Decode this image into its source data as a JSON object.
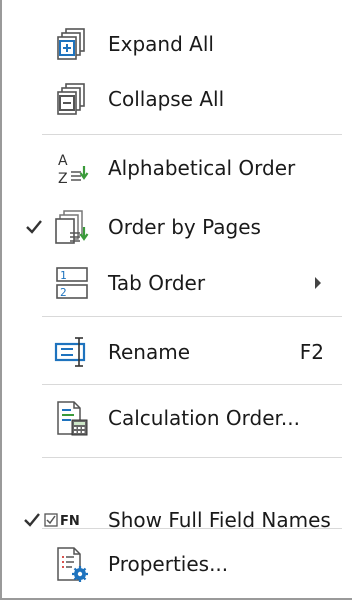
{
  "menu": {
    "expand_all": {
      "label": "Expand All",
      "icon": "expand-all-icon"
    },
    "collapse_all": {
      "label": "Collapse All",
      "icon": "collapse-all-icon"
    },
    "alphabetical_order": {
      "label": "Alphabetical Order",
      "icon": "sort-alphabetical-icon"
    },
    "order_by_pages": {
      "label": "Order by Pages",
      "icon": "order-by-pages-icon",
      "checked": true
    },
    "tab_order": {
      "label": "Tab Order",
      "icon": "tab-order-icon",
      "has_submenu": true,
      "tab_numbers": [
        "1",
        "2"
      ]
    },
    "rename": {
      "label": "Rename",
      "icon": "rename-icon",
      "shortcut": "F2"
    },
    "calculation_order": {
      "label": "Calculation Order...",
      "icon": "calculation-order-icon"
    },
    "show_full_field_names": {
      "label": "Show Full Field Names",
      "icon_text": "FN",
      "icon": "full-field-names-icon",
      "checked": true
    },
    "properties": {
      "label": "Properties...",
      "icon": "properties-icon"
    }
  },
  "colors": {
    "icon_blue": "#1e73be",
    "icon_gray": "#555555",
    "sort_green": "#3a9a3a",
    "separator": "#d9d9d9",
    "border": "#9a9a9a"
  }
}
